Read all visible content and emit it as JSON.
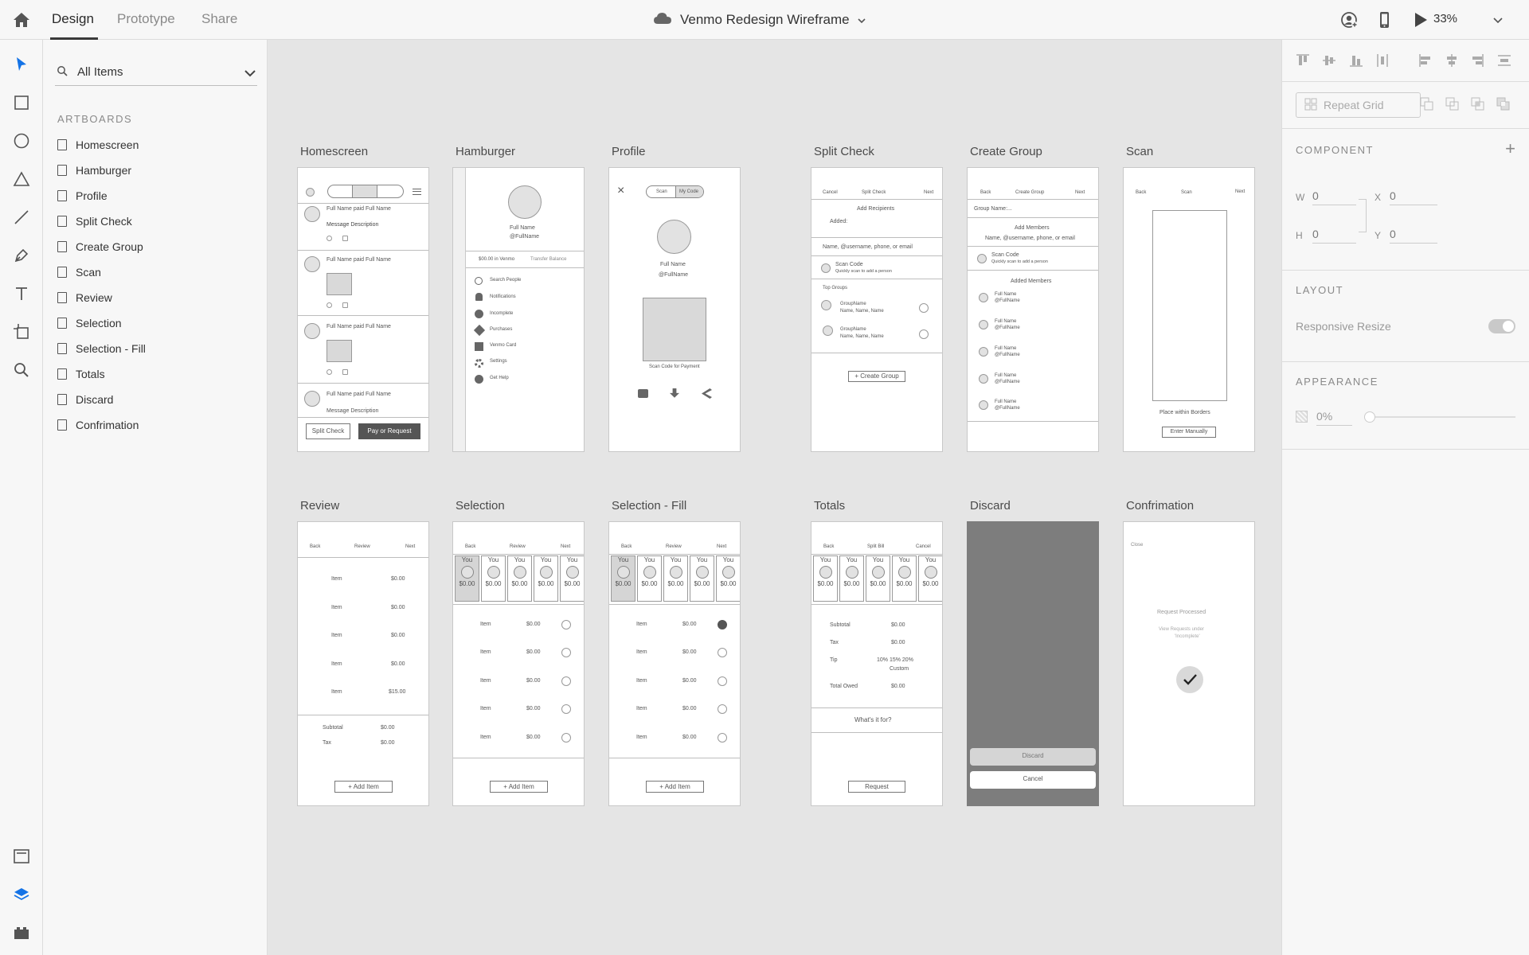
{
  "topbar": {
    "tabs": [
      "Design",
      "Prototype",
      "Share"
    ],
    "active_tab": "Design",
    "document_title": "Venmo Redesign Wireframe",
    "zoom": "33%"
  },
  "toolbar": {
    "tools": [
      "select-tool",
      "rectangle-tool",
      "ellipse-tool",
      "polygon-tool",
      "line-tool",
      "pen-tool",
      "text-tool",
      "artboard-tool",
      "zoom-tool"
    ],
    "bottom": [
      "assets-panel",
      "layers-panel",
      "plugins-panel"
    ]
  },
  "layers": {
    "filter": "All Items",
    "heading": "ARTBOARDS",
    "items": [
      "Homescreen",
      "Hamburger",
      "Profile",
      "Split Check",
      "Create Group",
      "Scan",
      "Review",
      "Selection",
      "Selection - Fill",
      "Totals",
      "Discard",
      "Confrimation"
    ]
  },
  "artboards": {
    "labels": [
      "Homescreen",
      "Hamburger",
      "Profile",
      "Split Check",
      "Create Group",
      "Scan",
      "Review",
      "Selection",
      "Selection - Fill",
      "Totals",
      "Discard",
      "Confrimation"
    ],
    "homescreen": {
      "posts": [
        {
          "line": "Full Name paid Full Name",
          "desc": "Message Description"
        },
        {
          "line": "Full Name paid Full Name"
        },
        {
          "line": "Full Name paid Full Name"
        },
        {
          "line": "Full Name paid Full Name",
          "desc": "Message Description"
        }
      ],
      "split_check": "Split Check",
      "pay_or_request": "Pay or Request"
    },
    "hamburger": {
      "name": "Full Name",
      "handle": "@FullName",
      "balance": "$00.00 in Venmo",
      "transfer": "Transfer Balance",
      "menu": [
        "Search People",
        "Notifications",
        "Incomplete",
        "Purchases",
        "Venmo Card",
        "Settings",
        "Get Help"
      ]
    },
    "profile": {
      "scan": "Scan",
      "my_code": "My Code",
      "name": "Full Name",
      "handle": "@FullName",
      "caption": "Scan Code for Payment"
    },
    "split_check": {
      "cancel": "Cancel",
      "title": "Split Check",
      "next": "Next",
      "add_recipients": "Add Recipients",
      "added": "Added:",
      "search": "Name, @username, phone, or email",
      "scan_code": "Scan Code",
      "scan_sub": "Quickly scan to add a person",
      "top_groups": "Top Groups",
      "groups": [
        {
          "name": "GroupName",
          "members": "Name, Name, Name"
        },
        {
          "name": "GroupName",
          "members": "Name, Name, Name"
        }
      ],
      "create_group": "+ Create Group"
    },
    "create_group": {
      "back": "Back",
      "title": "Create Group",
      "next": "Next",
      "group_name": "Group Name:...",
      "add_members": "Add Members",
      "search": "Name, @username, phone, or email",
      "scan_code": "Scan Code",
      "scan_sub": "Quickly scan to add a person",
      "added_members": "Added Members",
      "members": [
        {
          "name": "Full Name",
          "handle": "@FullName"
        },
        {
          "name": "Full Name",
          "handle": "@FullName"
        },
        {
          "name": "Full Name",
          "handle": "@FullName"
        },
        {
          "name": "Full Name",
          "handle": "@FullName"
        },
        {
          "name": "Full Name",
          "handle": "@FullName"
        }
      ]
    },
    "scan": {
      "back": "Back",
      "title": "Scan",
      "next": "Next",
      "place": "Place within Borders",
      "enter": "Enter Manually"
    },
    "review": {
      "back": "Back",
      "title": "Review",
      "next": "Next",
      "items": [
        {
          "name": "Item",
          "price": "$0.00"
        },
        {
          "name": "Item",
          "price": "$0.00"
        },
        {
          "name": "Item",
          "price": "$0.00"
        },
        {
          "name": "Item",
          "price": "$0.00"
        },
        {
          "name": "Item",
          "price": "$15.00"
        }
      ],
      "subtotal": "Subtotal",
      "subtotal_val": "$0.00",
      "tax": "Tax",
      "tax_val": "$0.00",
      "add_item": "+ Add Item"
    },
    "selection": {
      "back": "Back",
      "title": "Review",
      "next": "Next",
      "people": [
        "You",
        "You",
        "You",
        "You",
        "You"
      ],
      "amounts": [
        "$0.00",
        "$0.00",
        "$0.00",
        "$0.00",
        "$0.00"
      ],
      "items": [
        "Item",
        "Item",
        "Item",
        "Item",
        "Item"
      ],
      "prices": [
        "$0.00",
        "$0.00",
        "$0.00",
        "$0.00",
        "$0.00"
      ],
      "add_item": "+ Add Item"
    },
    "totals": {
      "back": "Back",
      "title": "Split Bill",
      "cancel": "Cancel",
      "subtotal": "Subtotal",
      "subtotal_val": "$0.00",
      "tax": "Tax",
      "tax_val": "$0.00",
      "tip": "Tip",
      "tip_options": "10%  15%  20%",
      "custom": "Custom",
      "total_owed": "Total Owed",
      "total_val": "$0.00",
      "whats_it_for": "What's it for?",
      "request": "Request"
    },
    "discard": {
      "discard": "Discard",
      "cancel": "Cancel"
    },
    "confirmation": {
      "close": "Close",
      "processed": "Request Processed",
      "view": "View Requests under",
      "incomplete": "'Incomplete'"
    }
  },
  "props": {
    "component": "COMPONENT",
    "w_label": "W",
    "w": "0",
    "h_label": "H",
    "h": "0",
    "x_label": "X",
    "x": "0",
    "y_label": "Y",
    "y": "0",
    "repeat_grid": "Repeat Grid",
    "layout": "LAYOUT",
    "responsive_resize": "Responsive Resize",
    "appearance": "APPEARANCE",
    "opacity": "0%"
  },
  "colors": {
    "accent": "#1473e6",
    "canvas": "#e5e5e5",
    "panel": "#f7f7f7",
    "discard_overlay": "#7d7d7d"
  }
}
